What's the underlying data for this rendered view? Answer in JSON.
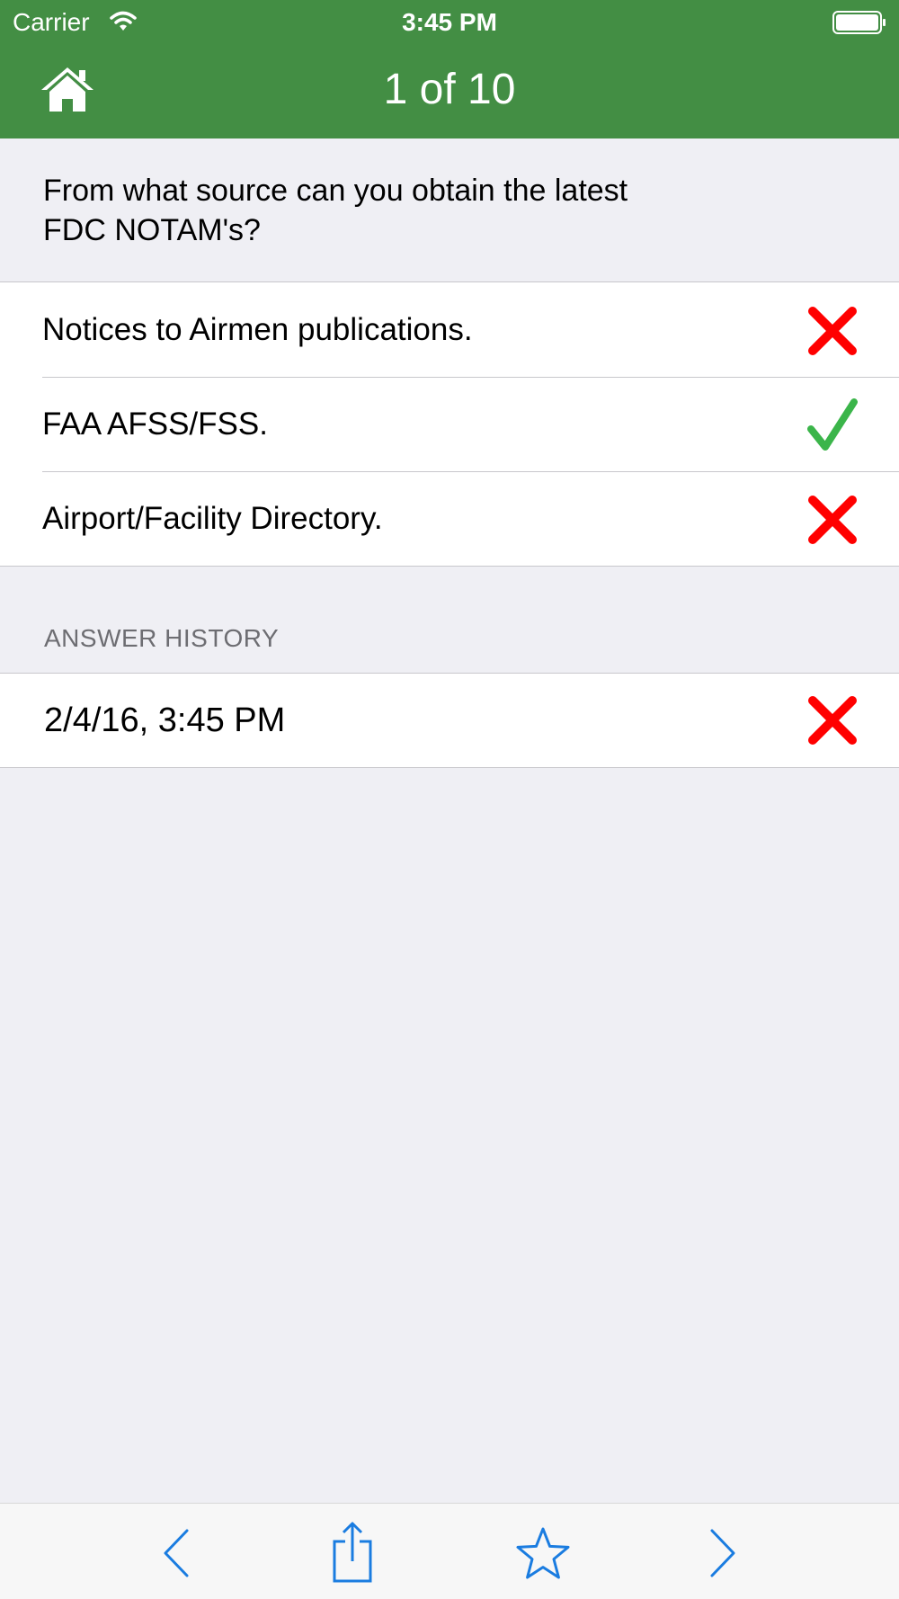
{
  "status_bar": {
    "carrier": "Carrier",
    "time": "3:45 PM",
    "icons": [
      "wifi-icon",
      "battery-icon"
    ]
  },
  "nav_bar": {
    "title": "1 of 10",
    "home_icon": "home-icon"
  },
  "question": {
    "text": "From what source can you obtain the latest FDC NOTAM's?"
  },
  "answers": [
    {
      "text": "Notices to Airmen publications.",
      "result": "incorrect",
      "icon": "cross-icon"
    },
    {
      "text": "FAA AFSS/FSS.",
      "result": "correct",
      "icon": "check-icon"
    },
    {
      "text": "Airport/Facility Directory.",
      "result": "incorrect",
      "icon": "cross-icon"
    }
  ],
  "history": {
    "header": "ANSWER HISTORY",
    "entries": [
      {
        "timestamp": "2/4/16, 3:45 PM",
        "result": "incorrect",
        "icon": "cross-icon"
      }
    ]
  },
  "toolbar": {
    "items": [
      "chevron-left-icon",
      "share-icon",
      "star-icon",
      "chevron-right-icon"
    ]
  },
  "colors": {
    "header_green": "#438e44",
    "background": "#efeff4",
    "incorrect_red": "#ff0000",
    "correct_green": "#3bb54a",
    "toolbar_blue": "#1a7ce0",
    "section_gray": "#6d6d72"
  }
}
